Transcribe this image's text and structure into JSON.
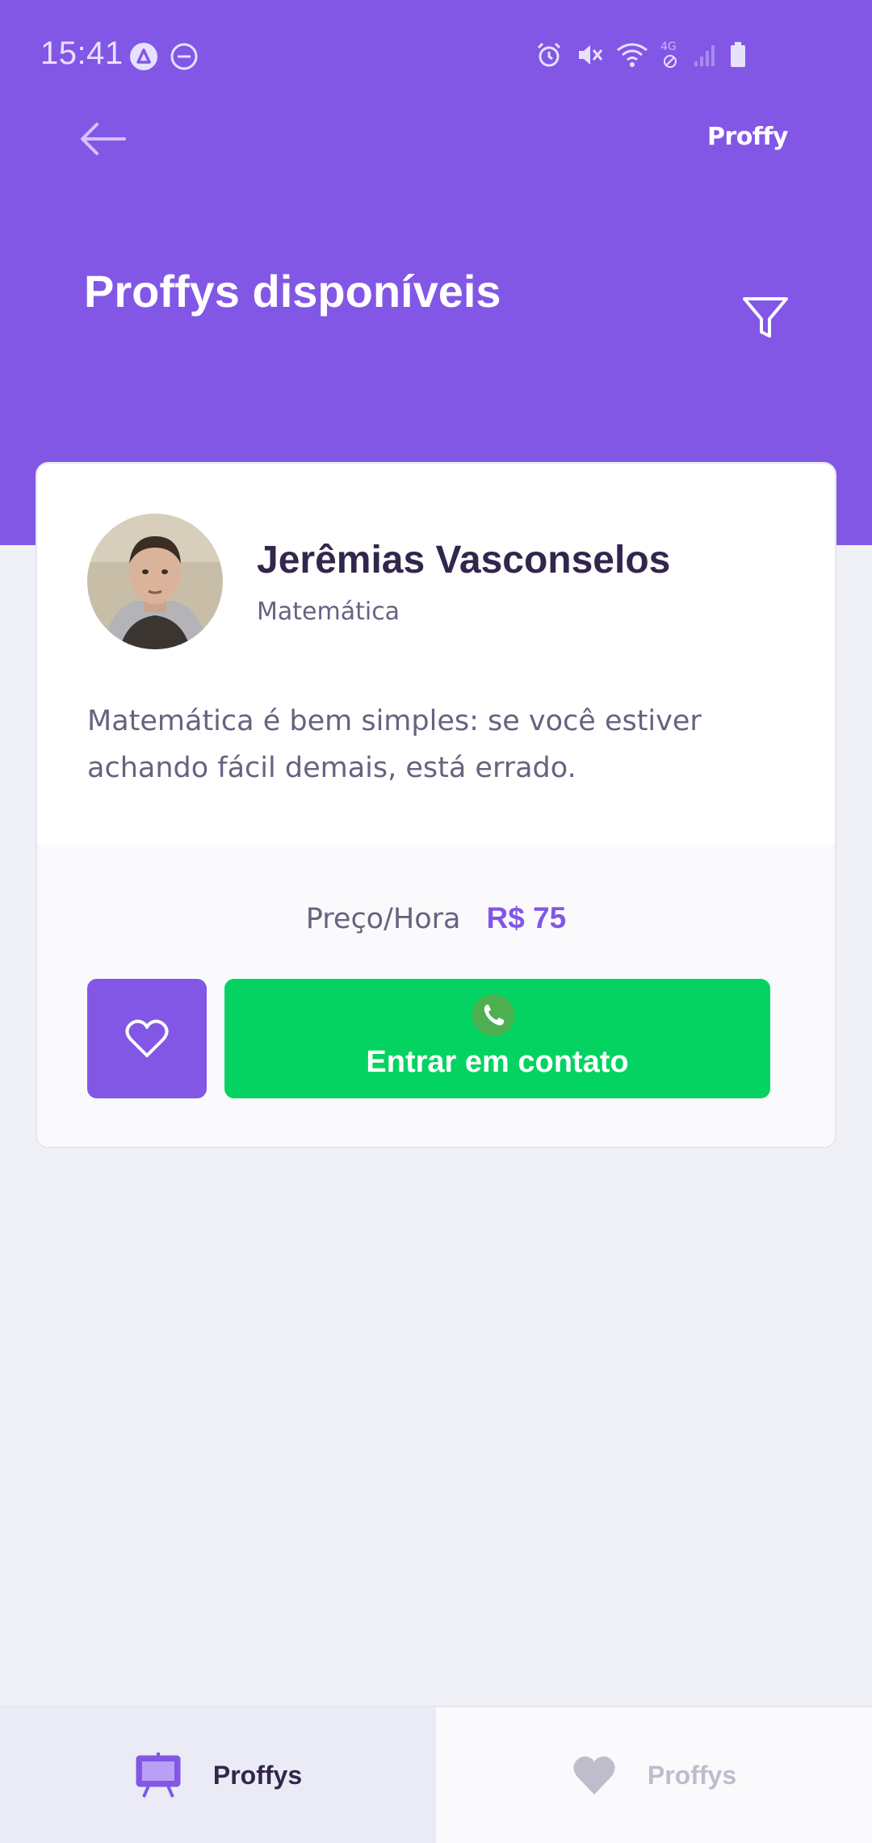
{
  "status_bar": {
    "time": "15:41",
    "network_label": "4G"
  },
  "header": {
    "brand": "Proffy",
    "title": "Proffys disponíveis",
    "accent_color": "#8257E5"
  },
  "teacher_card": {
    "name": "Jerêmias Vasconselos",
    "subject": "Matemática",
    "bio": "Matemática é bem simples: se você estiver achando fácil demais, está errado.",
    "price_label": "Preço/Hora",
    "price_value": "R$ 75",
    "contact_button_label": "Entrar em contato",
    "contact_color": "#04D361"
  },
  "tab_bar": {
    "tabs": [
      {
        "label": "Proffys",
        "icon": "easel-icon",
        "active": true
      },
      {
        "label": "Proffys",
        "icon": "heart-icon",
        "active": false
      }
    ]
  }
}
